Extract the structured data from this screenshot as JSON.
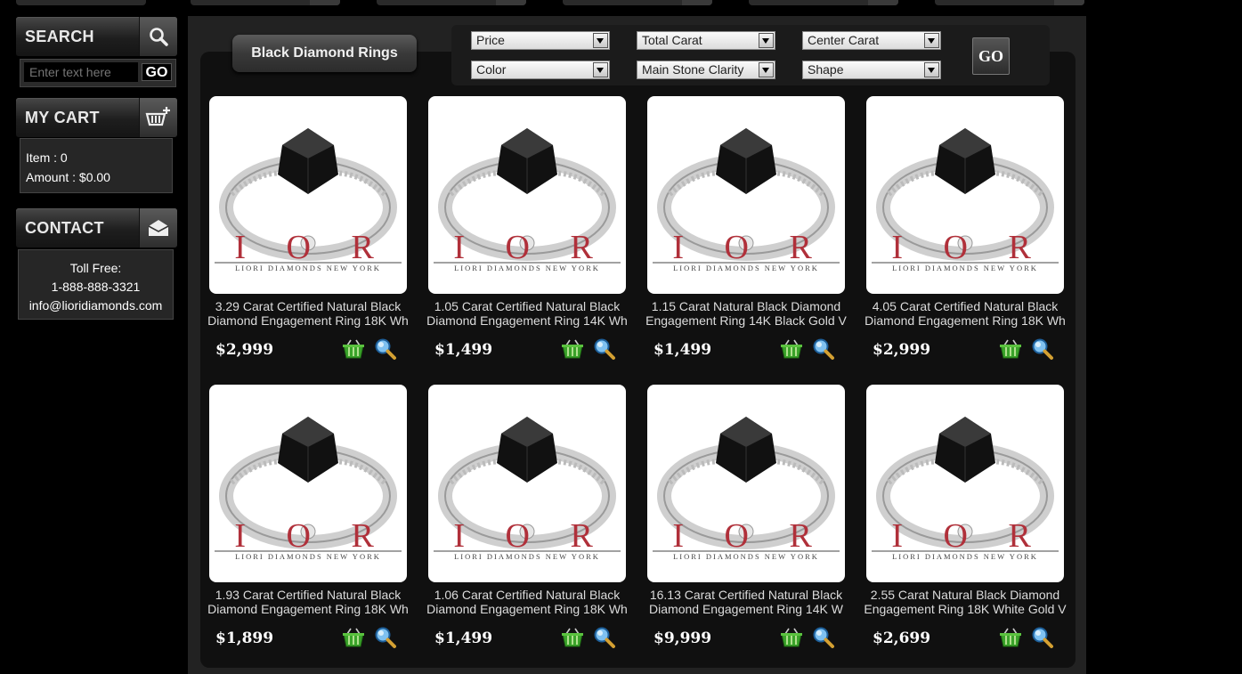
{
  "sidebar": {
    "search": {
      "title": "SEARCH",
      "placeholder": "Enter text here",
      "go_label": "GO"
    },
    "cart": {
      "title": "MY CART",
      "items_label": "Item : 0",
      "amount_label": "Amount : $0.00"
    },
    "contact": {
      "title": "CONTACT",
      "toll_free_label": "Toll Free:",
      "phone": "1-888-888-3321",
      "email": "info@lioridiamonds.com"
    }
  },
  "main": {
    "category_title": "Black Diamond Rings",
    "filters": [
      "Price",
      "Total Carat",
      "Center Carat",
      "Color",
      "Main Stone Clarity",
      "Shape"
    ],
    "go_label": "GO"
  },
  "brand": {
    "watermark": "L I O R I",
    "watermark_sub": "LIORI DIAMONDS NEW YORK"
  },
  "products": [
    {
      "name_line1": "3.29 Carat Certified Natural Black",
      "name_line2": "Diamond Engagement Ring 18K Wh",
      "price": "$2,999"
    },
    {
      "name_line1": "1.05 Carat Certified Natural Black",
      "name_line2": "Diamond Engagement Ring 14K Wh",
      "price": "$1,499"
    },
    {
      "name_line1": "1.15 Carat Natural Black Diamond",
      "name_line2": "Engagement Ring 14K Black Gold V",
      "price": "$1,499"
    },
    {
      "name_line1": "4.05 Carat Certified Natural Black",
      "name_line2": "Diamond Engagement Ring 18K Wh",
      "price": "$2,999"
    },
    {
      "name_line1": "1.93 Carat Certified Natural Black",
      "name_line2": "Diamond Engagement Ring 18K Wh",
      "price": "$1,899"
    },
    {
      "name_line1": "1.06 Carat Certified Natural Black",
      "name_line2": "Diamond Engagement Ring 18K Wh",
      "price": "$1,499"
    },
    {
      "name_line1": "16.13 Carat Certified Natural Black",
      "name_line2": "Diamond Engagement Ring 14K W",
      "price": "$9,999"
    },
    {
      "name_line1": "2.55 Carat Natural Black Diamond",
      "name_line2": "Engagement Ring 18K White Gold V",
      "price": "$2,699"
    }
  ],
  "icons": {
    "cart_action": "basket-icon",
    "zoom_action": "magnifier-icon"
  },
  "colors": {
    "accent_green": "#3aa32a",
    "brand_red": "#b0303a"
  }
}
